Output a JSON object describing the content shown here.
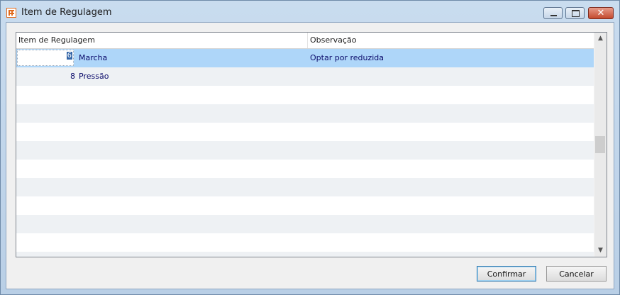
{
  "window": {
    "title": "Item de Regulagem"
  },
  "caption_buttons": {
    "close_glyph": "✕"
  },
  "grid": {
    "columns": [
      "Item de Regulagem",
      "Observação"
    ],
    "rows": [
      {
        "num": "6",
        "name": "Marcha",
        "obs": "Optar por reduzida",
        "selected": true
      },
      {
        "num": "8",
        "name": "Pressão",
        "obs": ""
      }
    ],
    "scroll_up_glyph": "▲",
    "scroll_down_glyph": "▼"
  },
  "buttons": {
    "confirm": "Confirmar",
    "cancel": "Cancelar"
  },
  "colors": {
    "selection": "#aed6f9",
    "alt_row": "#eef1f4",
    "text": "#0a0a6a"
  }
}
